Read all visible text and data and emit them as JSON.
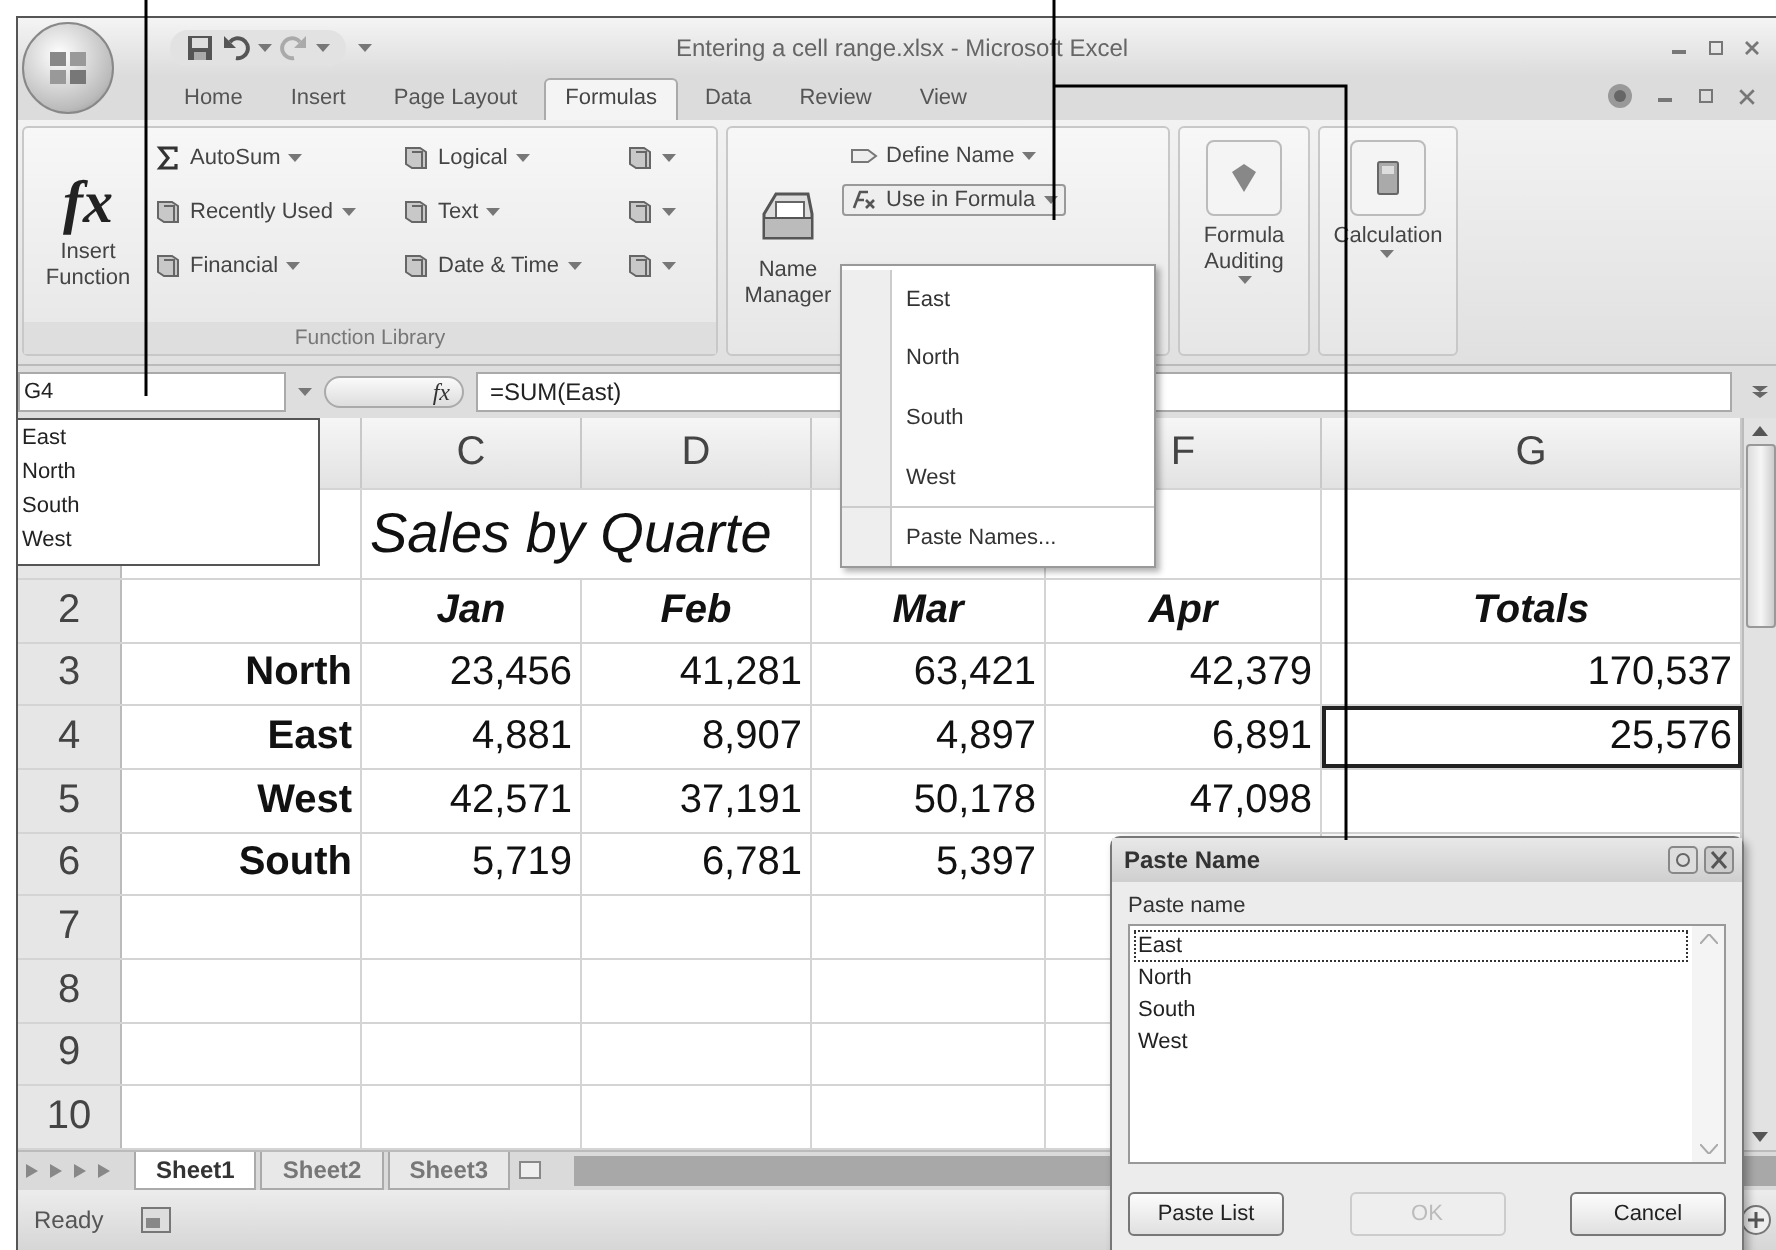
{
  "window": {
    "title": "Entering a cell range.xlsx - Microsoft Excel"
  },
  "ribbon_tabs": [
    {
      "label": "Home",
      "selected": false
    },
    {
      "label": "Insert",
      "selected": false
    },
    {
      "label": "Page Layout",
      "selected": false
    },
    {
      "label": "Formulas",
      "selected": true
    },
    {
      "label": "Data",
      "selected": false
    },
    {
      "label": "Review",
      "selected": false
    },
    {
      "label": "View",
      "selected": false
    }
  ],
  "function_library": {
    "label": "Function Library",
    "insert_function": {
      "glyph": "fx",
      "label": "Insert Function"
    },
    "commands": [
      {
        "label": "AutoSum",
        "kind": "sum"
      },
      {
        "label": "Recently Used",
        "kind": "book"
      },
      {
        "label": "Financial",
        "kind": "book"
      },
      {
        "label": "Logical",
        "kind": "book"
      },
      {
        "label": "Text",
        "kind": "book"
      },
      {
        "label": "Date & Time",
        "kind": "book"
      }
    ]
  },
  "defined_names": {
    "name_manager": "Name Manager",
    "define_name": "Define Name",
    "use_in_formula": {
      "label": "Use in Formula",
      "expanded": true,
      "menu": [
        {
          "label": "East",
          "kind": "name"
        },
        {
          "label": "North",
          "kind": "name"
        },
        {
          "label": "South",
          "kind": "name"
        },
        {
          "label": "West",
          "kind": "name"
        },
        {
          "label": "Paste Names...",
          "kind": "command"
        }
      ]
    }
  },
  "formula_auditing": "Formula Auditing",
  "calculation": "Calculation",
  "formula_bar": {
    "name_box": "G4",
    "fx": "fx",
    "formula": "=SUM(East)"
  },
  "name_box_list": [
    "East",
    "North",
    "South",
    "West"
  ],
  "sheet": {
    "column_headers": {
      "C": "C",
      "D": "D",
      "F": "F",
      "G": "G"
    },
    "rows": [
      {
        "kind": "title",
        "cells": {
          "C": {
            "value": "Sales by Quarte",
            "selected": false
          }
        }
      },
      {
        "kind": "heading",
        "header": "2",
        "cells": {
          "C": {
            "value": "Jan",
            "selected": false
          },
          "D": {
            "value": "Feb",
            "selected": false
          },
          "E": {
            "value": "Mar",
            "selected": false
          },
          "F": {
            "value": "Apr",
            "selected": false
          },
          "G": {
            "value": "Totals",
            "selected": false
          }
        }
      },
      {
        "kind": "data",
        "header": "3",
        "cells": {
          "B": {
            "value": "North",
            "selected": false
          },
          "C": {
            "value": "23,456",
            "selected": false
          },
          "D": {
            "value": "41,281",
            "selected": false
          },
          "E": {
            "value": "63,421",
            "selected": false
          },
          "F": {
            "value": "42,379",
            "selected": false
          },
          "G": {
            "value": "170,537",
            "selected": false
          }
        }
      },
      {
        "kind": "data",
        "header": "4",
        "cells": {
          "B": {
            "value": "East",
            "selected": false
          },
          "C": {
            "value": "4,881",
            "selected": false
          },
          "D": {
            "value": "8,907",
            "selected": false
          },
          "E": {
            "value": "4,897",
            "selected": false
          },
          "F": {
            "value": "6,891",
            "selected": false
          },
          "G": {
            "value": "25,576",
            "selected": true
          }
        }
      },
      {
        "kind": "data",
        "header": "5",
        "cells": {
          "B": {
            "value": "West",
            "selected": false
          },
          "C": {
            "value": "42,571",
            "selected": false
          },
          "D": {
            "value": "37,191",
            "selected": false
          },
          "E": {
            "value": "50,178",
            "selected": false
          },
          "F": {
            "value": "47,098",
            "selected": false
          }
        }
      },
      {
        "kind": "data",
        "header": "6",
        "cells": {
          "B": {
            "value": "South",
            "selected": false
          },
          "C": {
            "value": "5,719",
            "selected": false
          },
          "D": {
            "value": "6,781",
            "selected": false
          },
          "E": {
            "value": "5,397",
            "selected": false
          }
        }
      },
      {
        "kind": "empty",
        "header": "7"
      },
      {
        "kind": "empty",
        "header": "8"
      },
      {
        "kind": "empty",
        "header": "9"
      },
      {
        "kind": "empty",
        "header": "10"
      }
    ]
  },
  "paste_name_dialog": {
    "title": "Paste Name",
    "list_label": "Paste name",
    "names": [
      {
        "label": "East",
        "selected": true
      },
      {
        "label": "North",
        "selected": false
      },
      {
        "label": "South",
        "selected": false
      },
      {
        "label": "West",
        "selected": false
      }
    ],
    "buttons": [
      {
        "label": "Paste List",
        "disabled": false
      },
      {
        "label": "OK",
        "disabled": true
      },
      {
        "label": "Cancel",
        "disabled": false
      }
    ]
  },
  "sheet_tabs": [
    {
      "label": "Sheet1",
      "selected": true
    },
    {
      "label": "Sheet2",
      "selected": false
    },
    {
      "label": "Sheet3",
      "selected": false
    }
  ],
  "status_bar": {
    "text": "Ready"
  }
}
